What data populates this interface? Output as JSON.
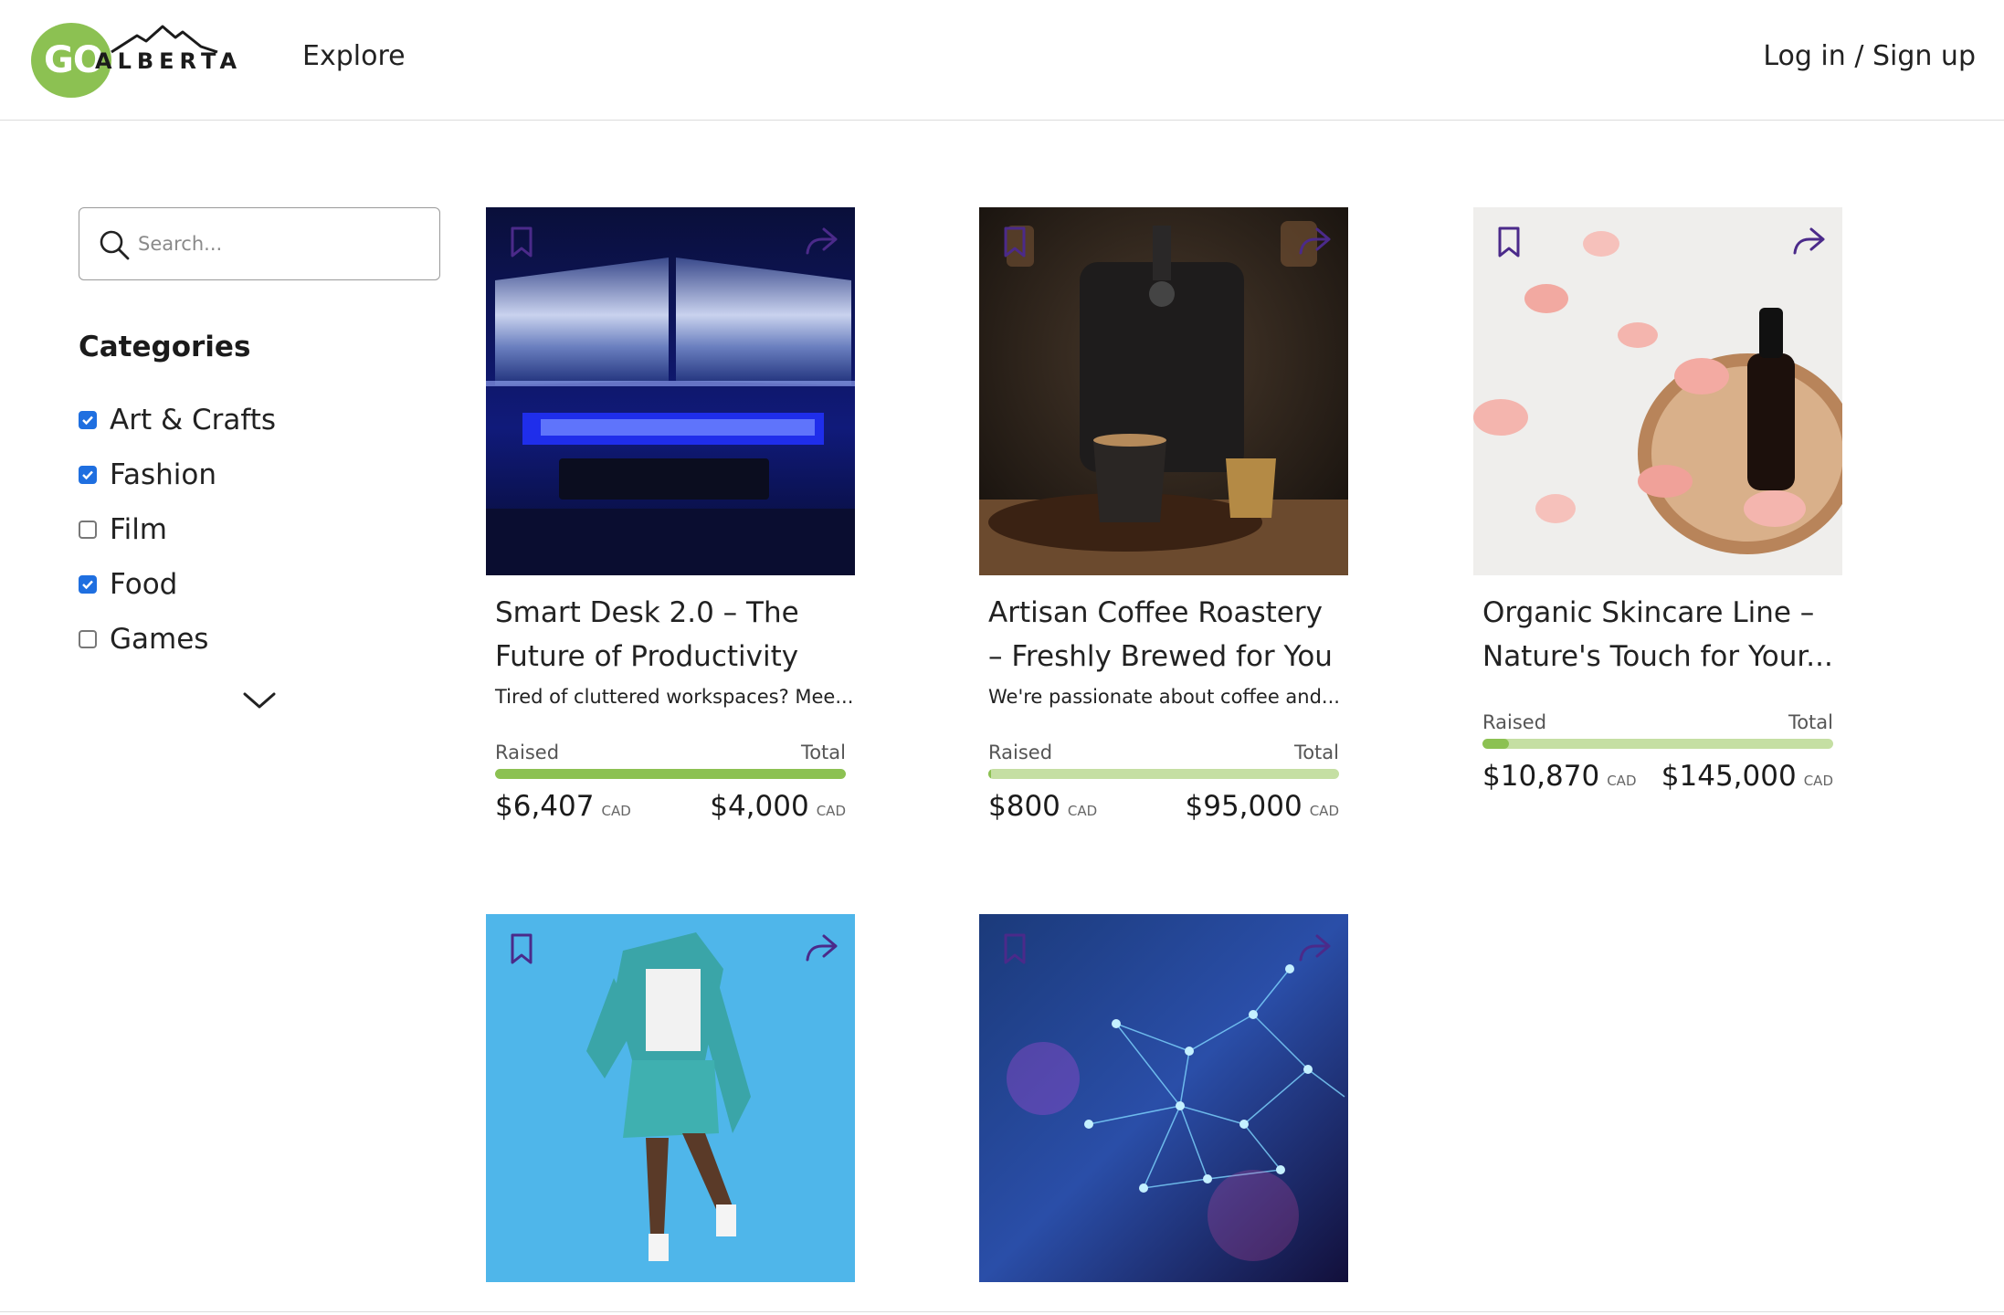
{
  "header": {
    "logo_go": "GO",
    "logo_alberta": "ALBERTA",
    "explore_label": "Explore",
    "login_label": "Log in / Sign up"
  },
  "sidebar": {
    "search_placeholder": "Search...",
    "categories_title": "Categories",
    "categories": [
      {
        "label": "Art & Crafts",
        "checked": true
      },
      {
        "label": "Fashion",
        "checked": true
      },
      {
        "label": "Film",
        "checked": false
      },
      {
        "label": "Food",
        "checked": true
      },
      {
        "label": "Games",
        "checked": false
      }
    ]
  },
  "cards": [
    {
      "title": "Smart Desk 2.0 – The Future of Productivity",
      "description": "Tired of cluttered workspaces? Mee...",
      "raised_label": "Raised",
      "total_label": "Total",
      "raised": "$6,407",
      "total": "$4,000",
      "currency": "CAD",
      "progress": 1.0
    },
    {
      "title": "Artisan Coffee Roastery – Freshly Brewed for You",
      "description": "We're passionate about coffee and...",
      "raised_label": "Raised",
      "total_label": "Total",
      "raised": "$800",
      "total": "$95,000",
      "currency": "CAD",
      "progress": 0.0084
    },
    {
      "title": "Organic Skincare Line – Nature's Touch for Your...",
      "description": "",
      "raised_label": "Raised",
      "total_label": "Total",
      "raised": "$10,870",
      "total": "$145,000",
      "currency": "CAD",
      "progress": 0.075
    },
    {
      "title": "",
      "description": ""
    },
    {
      "title": "",
      "description": ""
    }
  ],
  "icons": {
    "bookmark": "bookmark-icon",
    "share": "share-icon",
    "search": "search-icon",
    "chevron": "chevron-down-icon"
  },
  "colors": {
    "brand_green": "#8cc152",
    "progress_track": "#c5dfa3",
    "checkbox_blue": "#1f6fe0",
    "icon_purple": "#4b2a8a"
  }
}
